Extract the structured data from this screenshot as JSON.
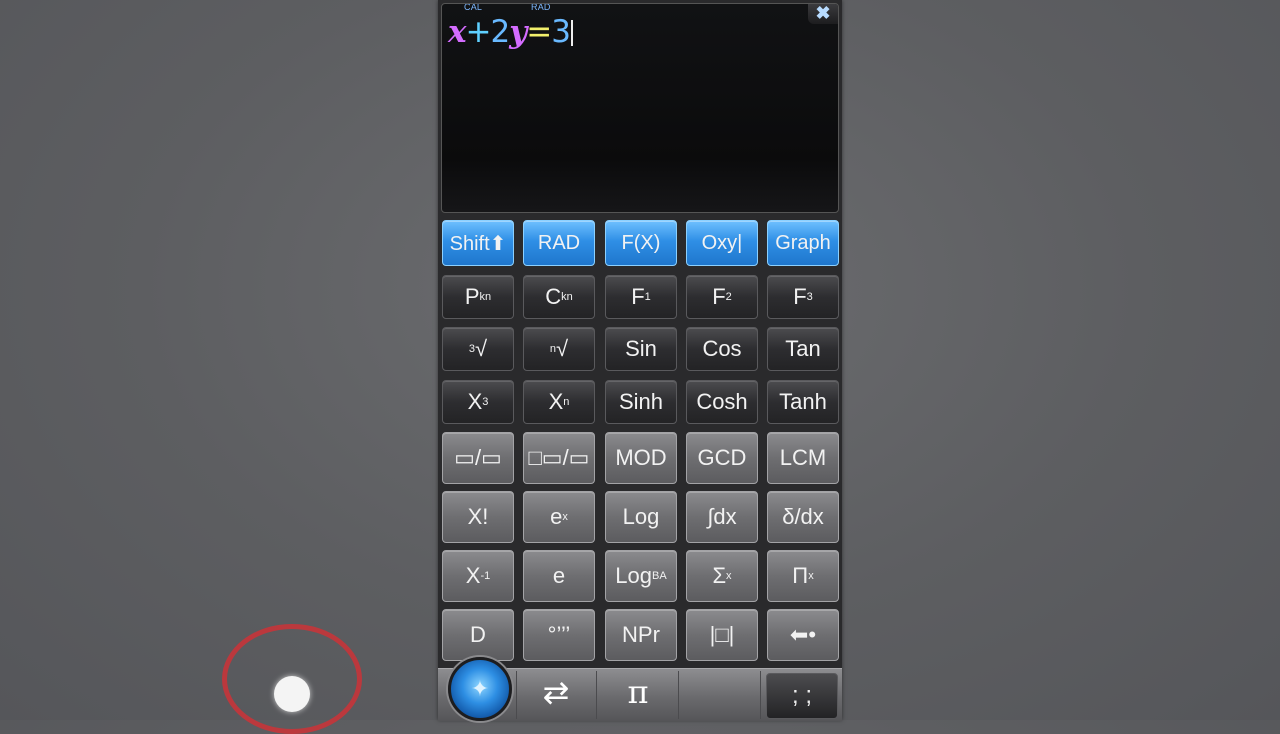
{
  "display": {
    "indicator_mode": "CAL",
    "indicator_angle": "RAD",
    "close_icon": "close-icon",
    "expression": [
      {
        "t": "x",
        "k": "v"
      },
      {
        "t": "+",
        "k": "op"
      },
      {
        "t": "2",
        "k": "n"
      },
      {
        "t": "y",
        "k": "v"
      },
      {
        "t": "=",
        "k": "eq"
      },
      {
        "t": "3",
        "k": "n"
      }
    ]
  },
  "keypad": {
    "rows": [
      [
        {
          "label": "Shift⬆",
          "style": "blue",
          "name": "shift-key"
        },
        {
          "label": "RAD",
          "style": "blue",
          "name": "rad-key"
        },
        {
          "label": "F(X)",
          "style": "blue",
          "name": "fx-key"
        },
        {
          "label": "Oxy|",
          "style": "blue",
          "name": "axis-key"
        },
        {
          "label": "Graph",
          "style": "blue",
          "name": "graph-key"
        }
      ],
      [
        {
          "label": "P",
          "sup": "k",
          "subn": "n",
          "style": "dark",
          "name": "permutation-key"
        },
        {
          "label": "C",
          "sup": "k",
          "subn": "n",
          "style": "dark",
          "name": "combination-key"
        },
        {
          "label": "F",
          "subn": "1",
          "style": "dark",
          "name": "f1-key"
        },
        {
          "label": "F",
          "subn": "2",
          "style": "dark",
          "name": "f2-key"
        },
        {
          "label": "F",
          "subn": "3",
          "style": "dark",
          "name": "f3-key"
        }
      ],
      [
        {
          "label": "√",
          "pre": "3",
          "style": "dark",
          "name": "cube-root-key"
        },
        {
          "label": "√",
          "pre": "n",
          "style": "dark",
          "name": "nth-root-key"
        },
        {
          "label": "Sin",
          "style": "dark",
          "name": "sin-key"
        },
        {
          "label": "Cos",
          "style": "dark",
          "name": "cos-key"
        },
        {
          "label": "Tan",
          "style": "dark",
          "name": "tan-key"
        }
      ],
      [
        {
          "label": "X",
          "sup": "3",
          "style": "dark",
          "name": "cube-key"
        },
        {
          "label": "X",
          "sup": "n",
          "style": "dark",
          "name": "power-key"
        },
        {
          "label": "Sinh",
          "style": "dark",
          "name": "sinh-key"
        },
        {
          "label": "Cosh",
          "style": "dark",
          "name": "cosh-key"
        },
        {
          "label": "Tanh",
          "style": "dark",
          "name": "tanh-key"
        }
      ],
      [
        {
          "label": "▭/▭",
          "style": "light",
          "name": "fraction-key"
        },
        {
          "label": "□▭/▭",
          "style": "light",
          "name": "mixed-fraction-key"
        },
        {
          "label": "MOD",
          "style": "light",
          "name": "mod-key"
        },
        {
          "label": "GCD",
          "style": "light",
          "name": "gcd-key"
        },
        {
          "label": "LCM",
          "style": "light",
          "name": "lcm-key"
        }
      ],
      [
        {
          "label": "X!",
          "style": "light",
          "name": "factorial-key"
        },
        {
          "label": "e",
          "sup": "x",
          "style": "light",
          "name": "exp-key"
        },
        {
          "label": "Log",
          "style": "light",
          "name": "log-key"
        },
        {
          "label": "∫dx",
          "style": "light",
          "name": "integral-key"
        },
        {
          "label": "δ/dx",
          "style": "light",
          "name": "derivative-key"
        }
      ],
      [
        {
          "label": "X",
          "sup": "-1",
          "style": "light",
          "name": "inverse-key"
        },
        {
          "label": "e",
          "style": "light",
          "name": "e-key"
        },
        {
          "label": "Log",
          "sup": "B",
          "subn": "A",
          "style": "light",
          "name": "log-base-key"
        },
        {
          "label": "Σ",
          "sup": "x",
          "style": "light",
          "name": "sum-key"
        },
        {
          "label": "Π",
          "sup": "x",
          "style": "light",
          "name": "product-key"
        }
      ],
      [
        {
          "label": "D",
          "style": "light",
          "name": "d-key"
        },
        {
          "label": "°’’’",
          "style": "light",
          "name": "degree-minute-second-key"
        },
        {
          "label": "NPr",
          "style": "light",
          "name": "npr-key"
        },
        {
          "label": "|□|",
          "style": "light",
          "name": "abs-key"
        },
        {
          "label": "⬅•",
          "style": "light",
          "name": "backspace-key"
        }
      ]
    ]
  },
  "bottom_bar": {
    "menu_icon": "globe-menu-icon",
    "swap_icon": "swap-arrows-icon",
    "swap_glyph": "⇄",
    "pi_label": "π",
    "semicolon_label": "; ;"
  }
}
